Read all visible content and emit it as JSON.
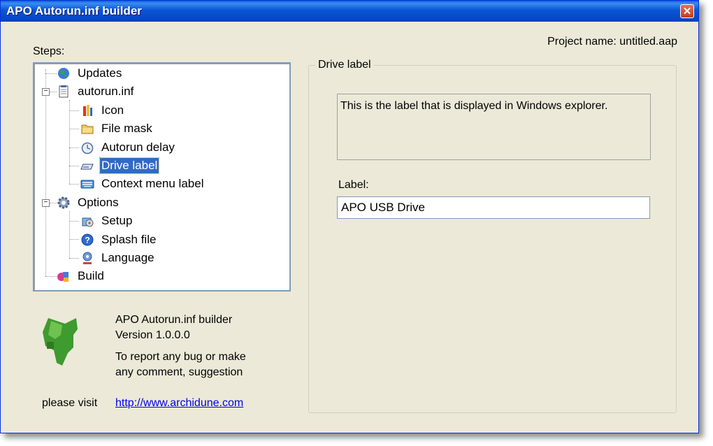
{
  "window": {
    "title": "APO Autorun.inf builder",
    "close_glyph": "✕"
  },
  "project": {
    "name_text": "Project name: untitled.aap"
  },
  "steps": {
    "label": "Steps:",
    "tree": [
      {
        "label": "Updates",
        "icon": "globe-icon"
      },
      {
        "label": "autorun.inf",
        "icon": "notepad-icon",
        "expanded": true
      },
      {
        "label": "Icon",
        "icon": "paint-icon"
      },
      {
        "label": "File mask",
        "icon": "folder-icon"
      },
      {
        "label": "Autorun delay",
        "icon": "clock-icon"
      },
      {
        "label": "Drive label",
        "icon": "drive-icon",
        "selected": true
      },
      {
        "label": "Context menu label",
        "icon": "keyboard-icon"
      },
      {
        "label": "Options",
        "icon": "gear-icon",
        "expanded": true
      },
      {
        "label": "Setup",
        "icon": "setup-icon"
      },
      {
        "label": "Splash file",
        "icon": "help-icon"
      },
      {
        "label": "Language",
        "icon": "language-icon"
      },
      {
        "label": "Build",
        "icon": "build-icon"
      }
    ]
  },
  "panel": {
    "group_title": "Drive label",
    "description": "This is the label that is displayed in Windows explorer.",
    "field_label": "Label:",
    "field_value": "APO USB Drive"
  },
  "about": {
    "app_name": "APO Autorun.inf builder",
    "version": "Version 1.0.0.0",
    "report_line1": "To report any bug or make",
    "report_line2": "any comment, suggestion",
    "visit_text": "please visit",
    "link": "http://www.archidune.com"
  },
  "colors": {
    "titlebar": "#0a55d4",
    "window_bg": "#ece9d8",
    "selection": "#316ac5",
    "link": "#0000ee"
  }
}
